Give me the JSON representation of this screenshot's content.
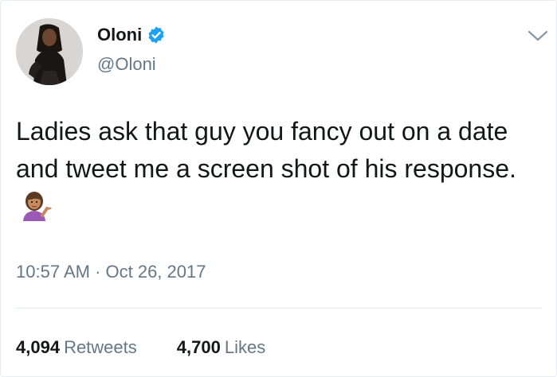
{
  "tweet": {
    "author": {
      "display_name": "Oloni",
      "handle": "@Oloni",
      "verified": true
    },
    "text": "Ladies ask that guy you fancy out on a date and tweet me a screen shot of his response.",
    "emoji": "woman-tipping-hand",
    "timestamp": "10:57 AM · Oct 26, 2017",
    "stats": {
      "retweets_count": "4,094",
      "retweets_label": "Retweets",
      "likes_count": "4,700",
      "likes_label": "Likes"
    }
  },
  "colors": {
    "text": "#14171a",
    "secondary": "#657786",
    "verified": "#1da1f2",
    "divider": "#e1e8ed"
  }
}
